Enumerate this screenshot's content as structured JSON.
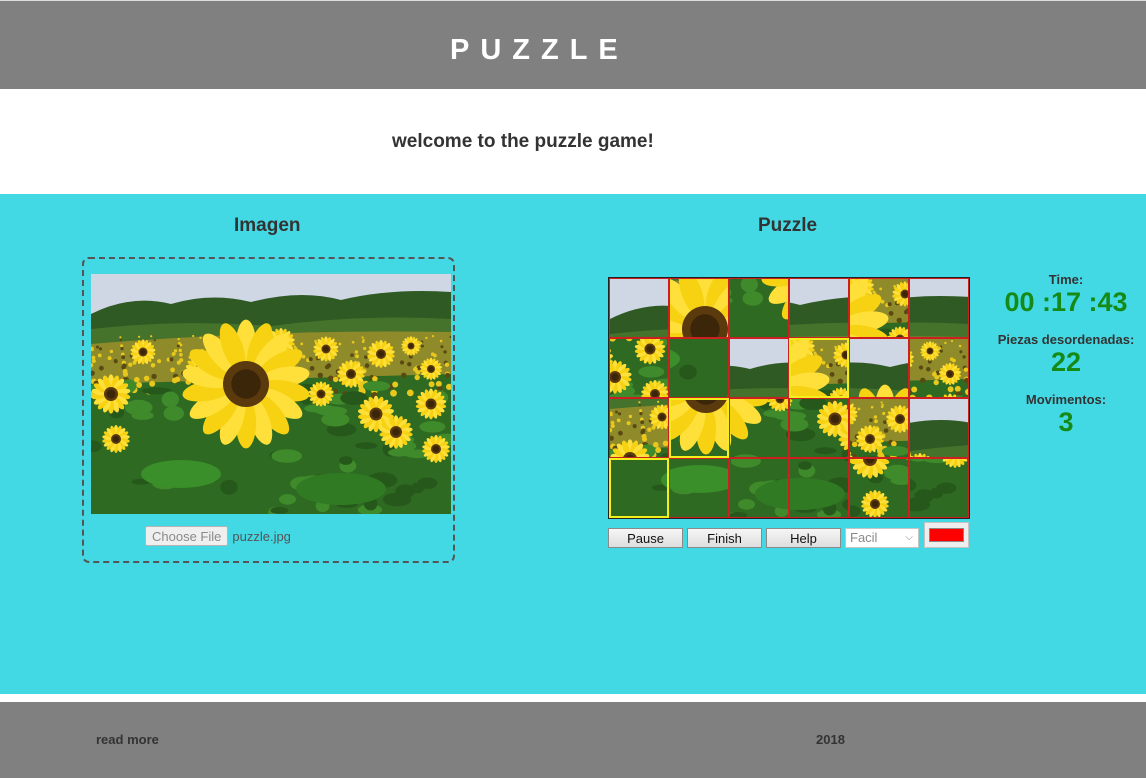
{
  "header": {
    "title": "PUZZLE"
  },
  "welcome": "welcome to the puzzle game!",
  "image_section": {
    "title": "Imagen",
    "choose_file_label": "Choose File",
    "file_name": "puzzle.jpg"
  },
  "puzzle_section": {
    "title": "Puzzle",
    "rows": 4,
    "cols": 6,
    "pieces": [
      {
        "src": 0,
        "correct": false
      },
      {
        "src": 8,
        "correct": false
      },
      {
        "src": 13,
        "correct": false
      },
      {
        "src": 4,
        "correct": false
      },
      {
        "src": 9,
        "correct": false
      },
      {
        "src": 5,
        "correct": false
      },
      {
        "src": 17,
        "correct": false
      },
      {
        "src": 20,
        "correct": false
      },
      {
        "src": 1,
        "correct": false
      },
      {
        "src": 9,
        "correct": true
      },
      {
        "src": 2,
        "correct": false
      },
      {
        "src": 11,
        "correct": false
      },
      {
        "src": 6,
        "correct": false
      },
      {
        "src": 14,
        "correct": true
      },
      {
        "src": 15,
        "correct": false
      },
      {
        "src": 16,
        "correct": false
      },
      {
        "src": 10,
        "correct": false
      },
      {
        "src": 3,
        "correct": false
      },
      {
        "src": 18,
        "correct": true
      },
      {
        "src": 19,
        "correct": false
      },
      {
        "src": 21,
        "correct": false
      },
      {
        "src": 22,
        "correct": false
      },
      {
        "src": 12,
        "correct": false
      },
      {
        "src": 23,
        "correct": false
      }
    ],
    "buttons": {
      "pause": "Pause",
      "finish": "Finish",
      "help": "Help"
    },
    "level": "Facil",
    "highlight_color": "#ff0000"
  },
  "stats": {
    "time_label": "Time:",
    "time_value": "00 :17 :43",
    "pieces_label": "Piezas desordenadas:",
    "pieces_value": "22",
    "moves_label": "Movimentos:",
    "moves_value": "3"
  },
  "footer": {
    "read_more": "read more",
    "year": "2018"
  }
}
